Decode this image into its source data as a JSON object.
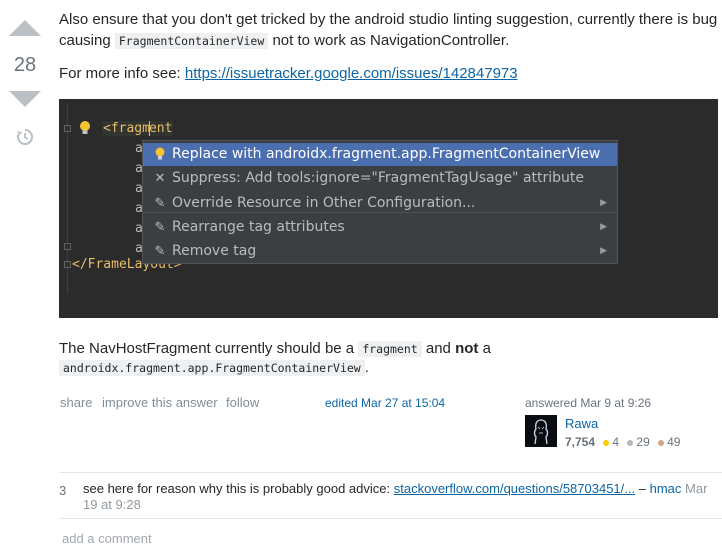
{
  "vote": {
    "count": "28"
  },
  "post": {
    "para1_text": "Also ensure that you don't get tricked by the android studio linting suggestion, currently there is bug",
    "para1b_prefix": "causing",
    "para1b_code": "FragmentContainerView",
    "para1b_suffix": "not to work as NavigationController.",
    "para2_prefix": "For more info see:",
    "para2_link": "https://issuetracker.google.com/issues/142847973",
    "para3_prefix": "The NavHostFragment currently should be a",
    "para3_code": "fragment",
    "para3_mid": "and",
    "para3_bold": "not",
    "para3_end": "a",
    "para4_code": "androidx.fragment.app.FragmentContainerView",
    "para4_end": "."
  },
  "ide": {
    "tag_open_pre": "<frag",
    "tag_open_caret_char": "m",
    "tag_open_post": "ent",
    "attr_letter": "a",
    "tag_close": "</FrameLayout>",
    "popup_items": [
      {
        "label": "Replace with androidx.fragment.app.FragmentContainerView",
        "icon": "lightbulb-icon",
        "selected": true
      },
      {
        "label": "Suppress: Add tools:ignore=\"FragmentTagUsage\" attribute",
        "icon": "close-icon"
      },
      {
        "label": "Override Resource in Other Configuration...",
        "icon": "edit-icon",
        "submenu": true
      },
      {
        "label": "Rearrange tag attributes",
        "icon": "edit-icon",
        "submenu": true
      },
      {
        "label": "Remove tag",
        "icon": "edit-icon",
        "submenu": true
      }
    ]
  },
  "post_menu": {
    "share": "share",
    "improve": "improve this answer",
    "follow": "follow"
  },
  "edited": {
    "text": "edited Mar 27 at 15:04"
  },
  "answered": {
    "text": "answered Mar 9 at 9:26",
    "user": "Rawa",
    "reputation": "7,754",
    "gold": "4",
    "silver": "29",
    "bronze": "49"
  },
  "comment": {
    "score": "3",
    "text": "see here for reason why this is probably good advice:",
    "link": "stackoverflow.com/questions/58703451/...",
    "dash": "–",
    "user": "hmac",
    "date_a": "Mar",
    "date_b": "19 at 9:28"
  },
  "add_comment": "add a comment",
  "colors": {
    "link": "#0c65a5",
    "ide_background": "#2b2b2b",
    "popup_selected": "#4b6eaf",
    "gold": "#ffcc01",
    "silver": "#b4b8bc",
    "bronze": "#d1a684"
  }
}
